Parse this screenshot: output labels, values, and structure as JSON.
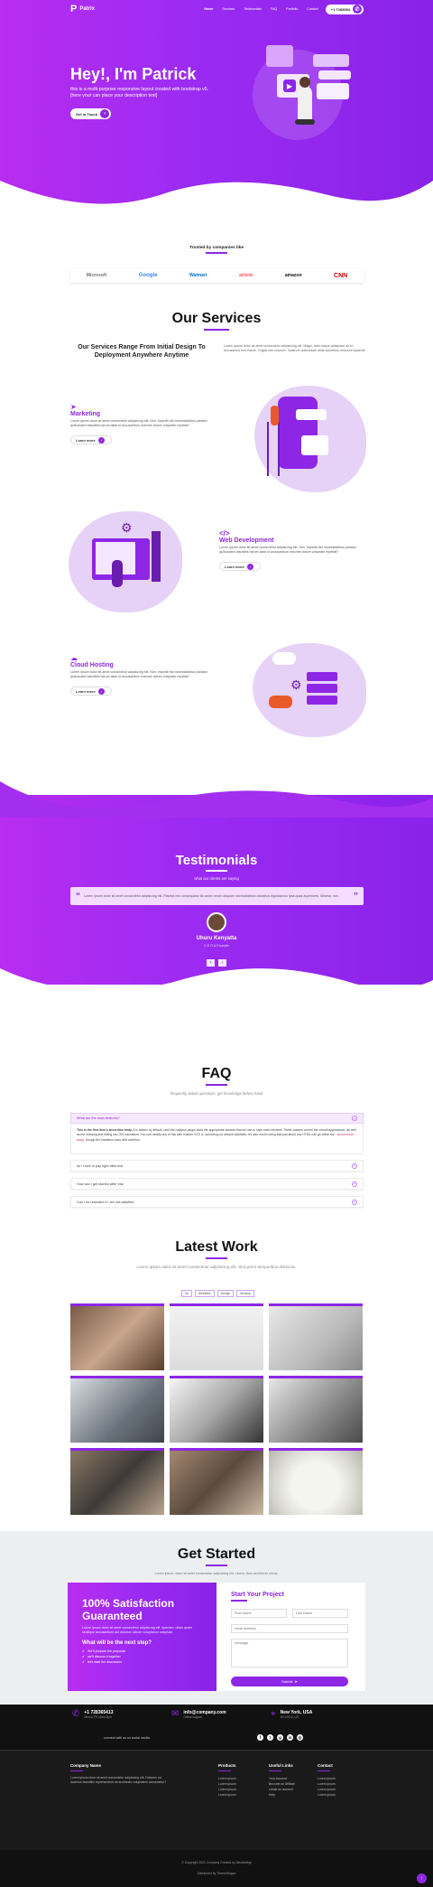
{
  "nav": {
    "brand": "Patrix",
    "items": [
      "Home",
      "Services",
      "Testimonials",
      "FAQ",
      "Portfolio",
      "Contact"
    ],
    "phone": "+1 7283654"
  },
  "hero": {
    "title": "Hey!, I'm Patrick",
    "subtitle": "this is a multi-purpose responsive layout created with bootstrap v5. [here your can place your description text]",
    "button": "Get in Touch"
  },
  "trusted": {
    "title": "Trusted by companies like",
    "logos": [
      "Microsoft",
      "Google",
      "Walmart",
      "airbnb",
      "amazon",
      "CNN"
    ]
  },
  "services": {
    "title": "Our Services",
    "lead": "Our Services Range From Initial Design To Deployment Anywhere Anytime",
    "lead_text": "Lorem ipsum dolor sit amet consectetur adipisicing elit. Magni, ipsa eaque quisquam sit et accusamus eos earum. Fugiat iure nostrum. Nostrum quibusdam alias doloribus, nesciunt quaerat!",
    "items": [
      {
        "title": "Marketing",
        "text": "Lorem ipsum dolor sit amet consectetur adipisicing elit. Non, impedit nisi necessitatibus pariatur quibusdam blanditiis harum alias id accusantium maxime dolore voluptate repellat?",
        "button": "Learn more",
        "icon": "paper-plane-icon"
      },
      {
        "title": "Web Development",
        "text": "Lorem ipsum dolor sit amet consectetur adipisicing elit. Non, impedit nisi necessitatibus pariatur quibusdam blanditiis harum alias id accusantium maxime dolore voluptate repellat?",
        "button": "Learn more",
        "icon": "code-icon"
      },
      {
        "title": "Cloud Hosting",
        "text": "Lorem ipsum dolor sit amet consectetur adipisicing elit. Non, impedit nisi necessitatibus pariatur quibusdam blanditiis harum alias id accusantium maxime dolore voluptate repellat?",
        "button": "Learn more",
        "icon": "cloud-icon"
      }
    ]
  },
  "testimonials": {
    "title": "Testimonials",
    "subtitle": "what our clients are saying",
    "quote": "Lorem ipsum dolor sit amet consectetur adipisicing elit. Placeat eos consequatur illo animi rerum aliquam necessitatibus doloribus dignissimos ipsa quas asperiores. Minima, non.",
    "name": "Uhuru Kenyatta",
    "role": "C.E.O & Founder",
    "prev": "‹",
    "next": "›"
  },
  "faq": {
    "title": "FAQ",
    "subtitle": "frequently asked questions, get knowledge befere hand",
    "open_question": "What are the main features?",
    "open_answer_bold": "This is the first item's accordion body.",
    "open_answer": " It is hidden by default, until the collapse plugin adds the appropriate classes that we use to style each element. These classes control the overall appearance, as well as the showing and hiding via CSS transitions. You can modify any of this with custom CSS or overriding our default variables. It's also worth noting that just about any HTML can go within the",
    "open_answer_code": ".accordion-body",
    "open_answer_end": ", though the transition does limit overflow.",
    "questions": [
      "do I have to pay right after trial",
      "How can I get started after trial",
      "Can I be refunded if I am not satisfied"
    ]
  },
  "work": {
    "title": "Latest Work",
    "subtitle": "Lorem ipsum dolor sit amet consectetur adipisicing elit. Sint porro temporibus distinctio.",
    "filters": [
      "All",
      "Websites",
      "Design",
      "Mockup"
    ]
  },
  "get_started": {
    "title": "Get Started",
    "subtitle": "Lorem ipsum, dolor sit amet consectetur adipisicing elit. Libero, illum architecto minus.",
    "left_title": "100% Satisfaction Guaranteed",
    "left_text": "Lorem ipsum dolor sit amet consectetur adipisicing elit. Aperiam, ullam quam similique accusantium aut dolorum labore voluptatum voluptate.",
    "left_sub": "What will be the next step?",
    "steps": [
      "We'll prepare the proposal",
      "we'll discuss it together",
      "let's start the discussion"
    ],
    "form_title": "Start Your Project",
    "first_name": "First Name",
    "last_name": "Last Name",
    "email": "email address",
    "message": "message",
    "submit": "Submit"
  },
  "contact_bar": {
    "phone": "+1 728365413",
    "phone_sub": "Mon to Fri 10am-4pm",
    "email": "info@company.com",
    "email_sub": "Online support",
    "address": "New York, USA",
    "address_sub": "NY 10012, US",
    "social_text": "connect with us on social media"
  },
  "footer": {
    "col1_title": "Company Name",
    "col1_text": "Lorem ipsum dolor sit amet consectetur adipisicing elit. Dolorem ea ducimus blanditiis reprehenderit de architecto voluptatem consectetur?",
    "col2_title": "Products",
    "col2_links": [
      "Lorem ipsum",
      "Lorem ipsum",
      "Lorem ipsum",
      "Lorem ipsum"
    ],
    "col3_title": "Useful Links",
    "col3_links": [
      "Your Account",
      "Become an Affiliate",
      "create an account",
      "Help"
    ],
    "col4_title": "Contact",
    "col4_links": [
      "Lorem ipsum",
      "Lorem ipsum",
      "Lorem ipsum",
      "Lorem ipsum"
    ],
    "copyright": "© Copyright 2021 Company Created by Mazitzelegi",
    "distributed": "Distributed by ThemeWagon"
  },
  "colors": {
    "accent": "#8e26e6",
    "gradient_start": "#b82df0",
    "gradient_end": "#8a22e8",
    "footer": "#1a1a1a"
  }
}
